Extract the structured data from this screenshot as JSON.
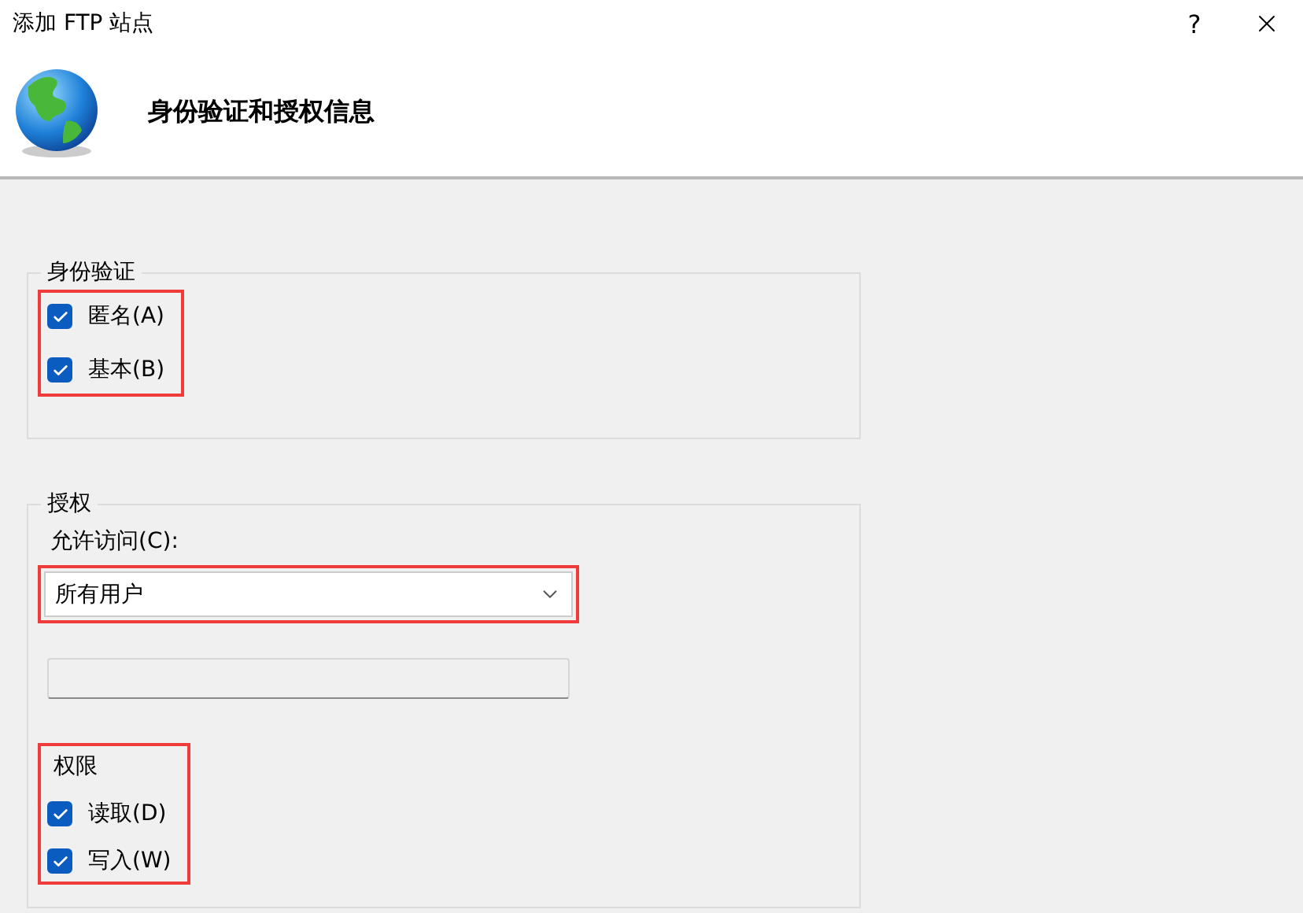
{
  "window": {
    "title": "添加 FTP 站点",
    "help_glyph": "?"
  },
  "header": {
    "title": "身份验证和授权信息"
  },
  "authentication": {
    "legend": "身份验证",
    "highlighted": true,
    "options": [
      {
        "label": "匿名(A)",
        "checked": true
      },
      {
        "label": "基本(B)",
        "checked": true
      }
    ]
  },
  "authorization": {
    "legend": "授权",
    "access_label": "允许访问(C):",
    "access_select": {
      "value": "所有用户",
      "highlighted": true
    },
    "extra_field": {
      "disabled": true
    },
    "permissions": {
      "label": "权限",
      "highlighted": true,
      "options": [
        {
          "label": "读取(D)",
          "checked": true
        },
        {
          "label": "写入(W)",
          "checked": true
        }
      ]
    }
  }
}
